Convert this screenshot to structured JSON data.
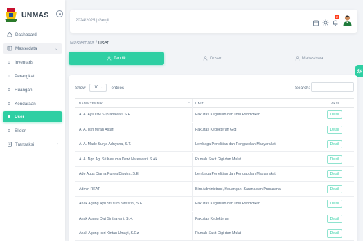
{
  "brand": {
    "name": "UNMAS"
  },
  "sidebar": {
    "items": [
      {
        "label": "Dashboard",
        "icon": "home-icon"
      },
      {
        "label": "Masterdata",
        "icon": "folder-icon"
      },
      {
        "label": "Inventaris"
      },
      {
        "label": "Perangkat"
      },
      {
        "label": "Ruangan"
      },
      {
        "label": "Kendaraan"
      },
      {
        "label": "User"
      },
      {
        "label": "Slider"
      },
      {
        "label": "Transaksi",
        "icon": "document-icon"
      }
    ]
  },
  "header": {
    "period": "2024/2025 | Genjil",
    "notification_count": "2"
  },
  "breadcrumb": {
    "parent": "Masterdata /",
    "current": "User"
  },
  "tabs": [
    {
      "label": "Tendik"
    },
    {
      "label": "Dosen"
    },
    {
      "label": "Mahasiswa"
    }
  ],
  "table_controls": {
    "show_label": "Show",
    "entries_value": "10",
    "entries_label": "entries",
    "search_label": "Search:"
  },
  "table": {
    "headers": [
      "NAMA TENDIK",
      "UNIT",
      "AKSI"
    ],
    "action_label": "Detail",
    "rows": [
      {
        "name": "A. A. Ayu Dwi Suprabawati, S.E.",
        "unit": "Fakultas Keguruan dan Ilmu Pendidikan"
      },
      {
        "name": "A. A. Istri Mirah Astari",
        "unit": "Fakultas Kedokteran Gigi"
      },
      {
        "name": "A. A. Made Surya Adnyana, S.T.",
        "unit": "Lembaga Penelitian dan Pengabdian Masyarakat"
      },
      {
        "name": "A. A. Ngr. Ag. Sri Kesuma Dewi Nareswari, S.Ak",
        "unit": "Rumah Sakit Gigi dan Mulut"
      },
      {
        "name": "Ade Agus Diama Purwa Diputra, S.E.",
        "unit": "Lembaga Penelitian dan Pengabdian Masyarakat"
      },
      {
        "name": "Admin RKAT",
        "unit": "Biro Administrasi, Keuangan, Sarana dan Prasarana"
      },
      {
        "name": "Anak Agung Ayu Sri Yum Swastini, S.E.",
        "unit": "Fakultas Keguruan dan Ilmu Pendidikan"
      },
      {
        "name": "Anak Agung Dwi Sinthayani, S.H.",
        "unit": "Fakultas Kedokteran"
      },
      {
        "name": "Anak Agung Istri Kintan Umayi, S.Gz",
        "unit": "Rumah Sakit Gigi dan Mulut"
      }
    ]
  },
  "colors": {
    "accent": "#2ecfa3",
    "badge": "#ff3e1d"
  }
}
